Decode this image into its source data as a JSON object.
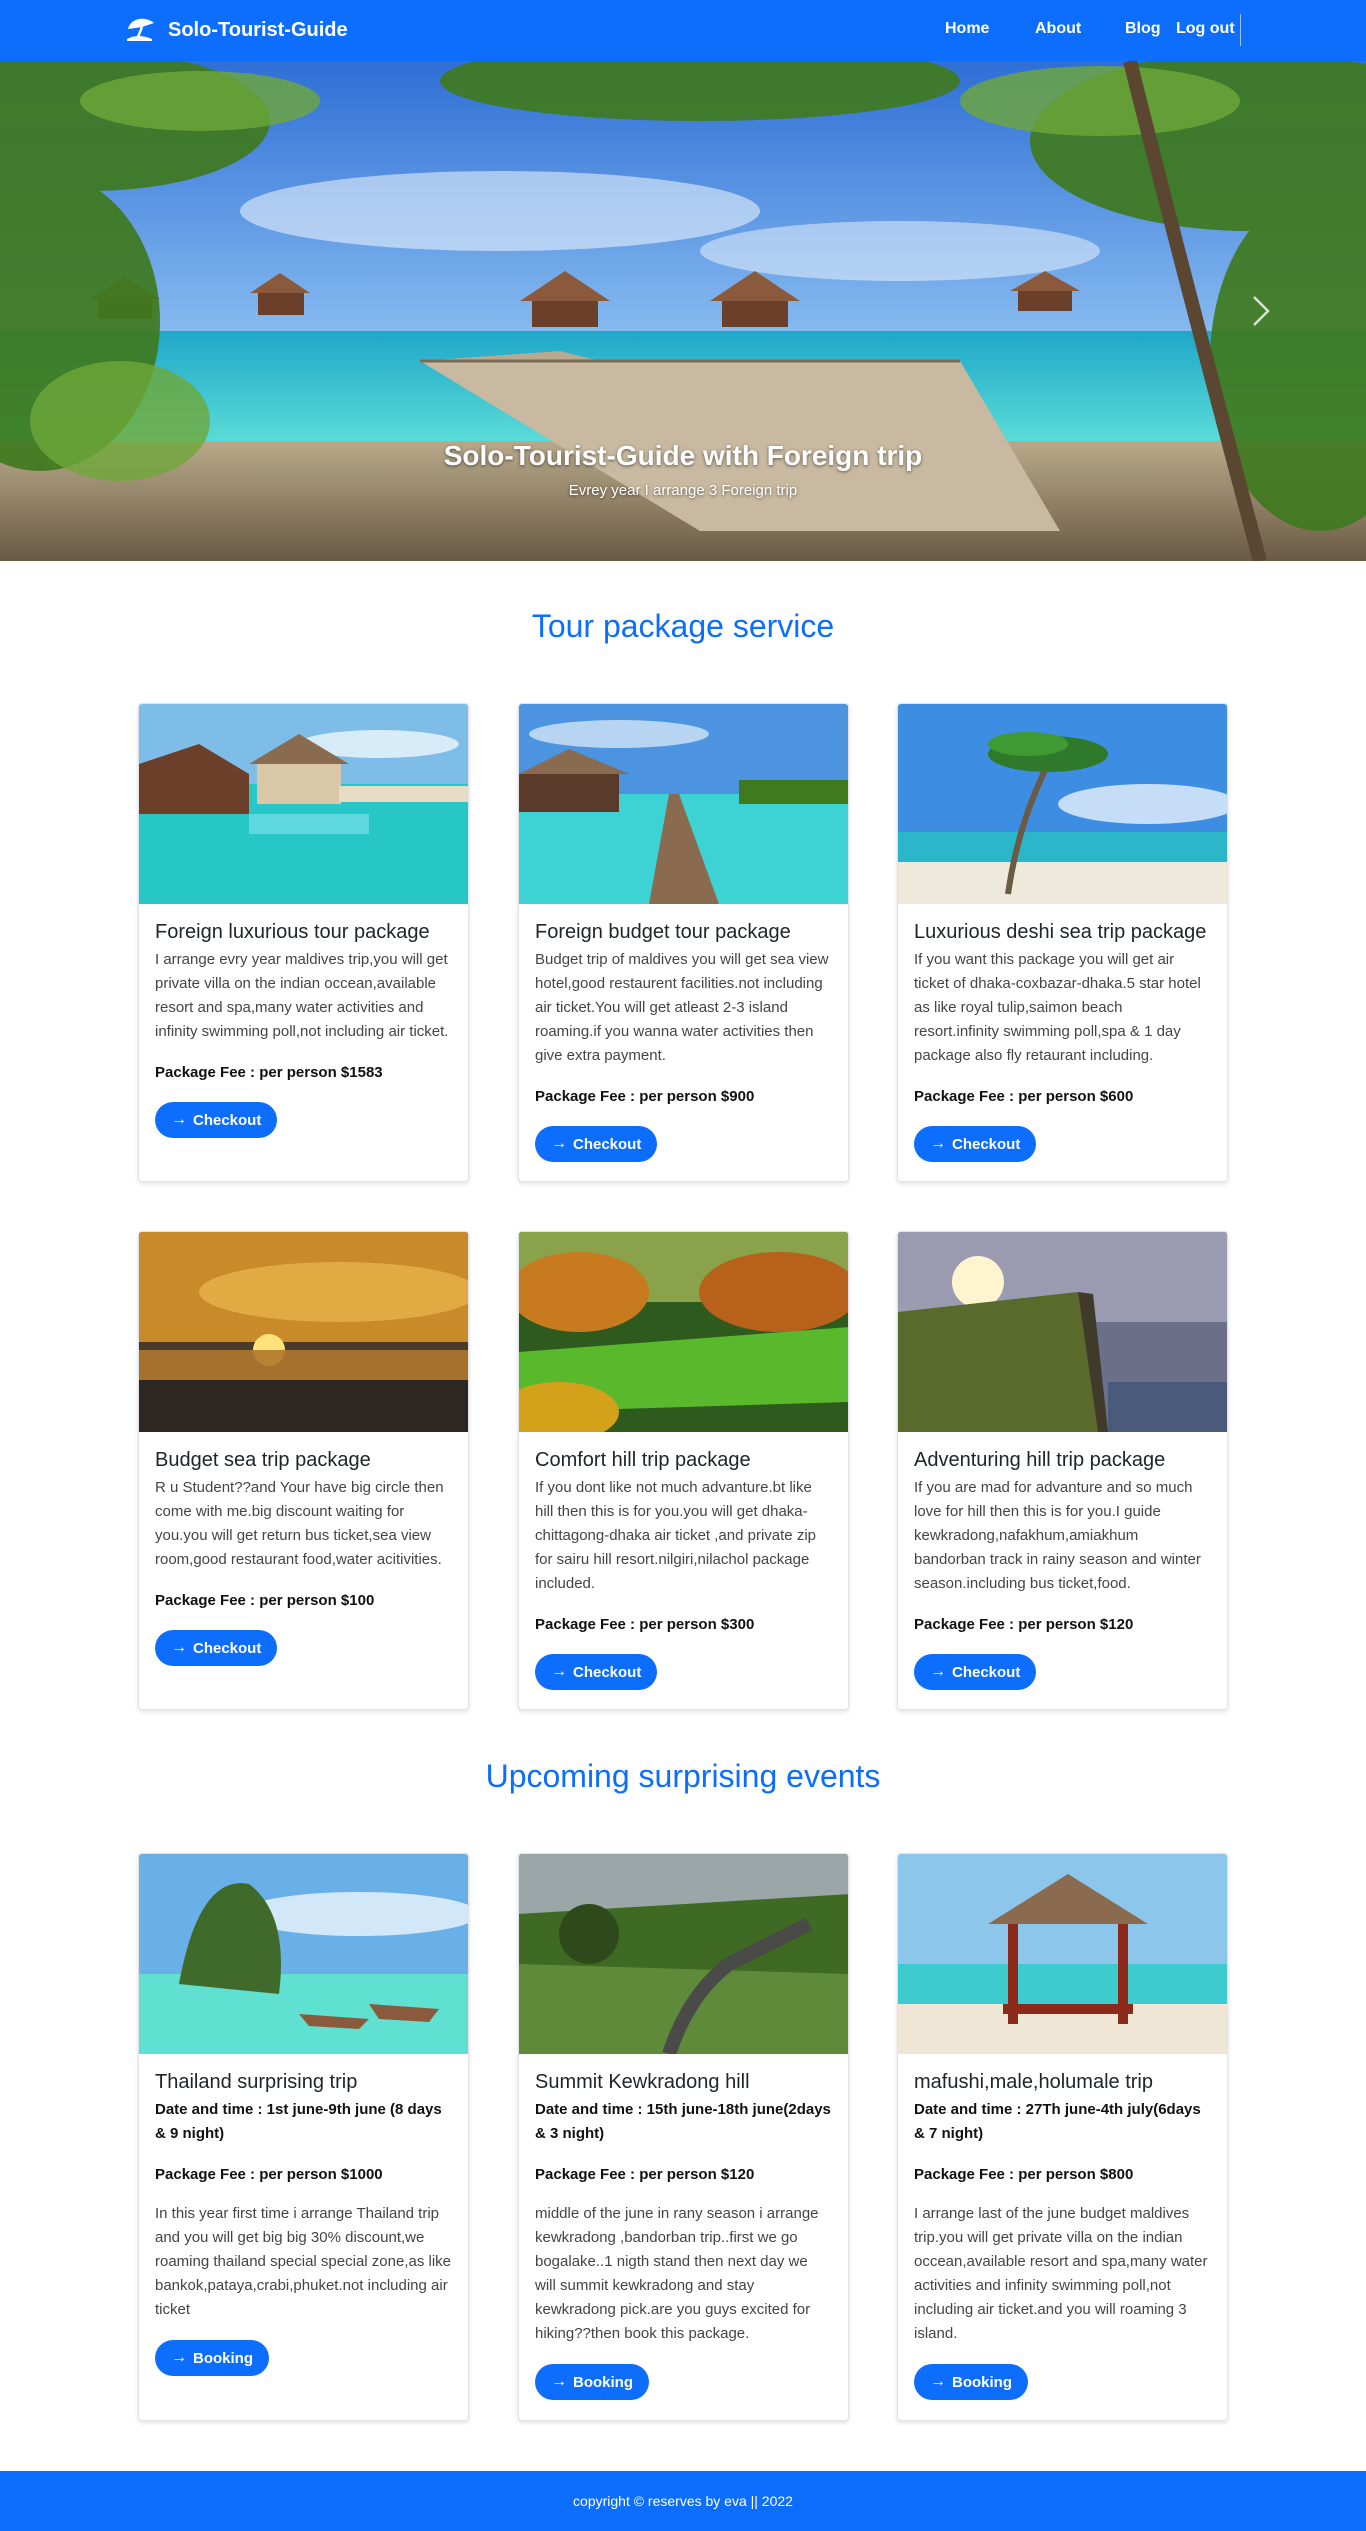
{
  "navbar": {
    "brand": "Solo-Tourist-Guide",
    "home": "Home",
    "about": "About",
    "blog": "Blog",
    "logout": "Log out",
    "color": "#0d6efd"
  },
  "hero": {
    "title": "Solo-Tourist-Guide with Foreign trip",
    "subtitle": "Evrey year I arrange 3 Foreign trip"
  },
  "packages": {
    "section_title": "Tour package service",
    "items": [
      {
        "title": "Foreign luxurious tour package",
        "description": "I arrange evry year maldives trip,you will get private villa on the indian occean,available resort and spa,many water activities and infinity swimming poll,not including air ticket.",
        "fee": "Package Fee : per person $1583",
        "button": "Checkout"
      },
      {
        "title": "Foreign budget tour package",
        "description": "Budget trip of maldives you will get sea view hotel,good restaurent facilities.not including air ticket.You will get atleast 2-3 island roaming.if you wanna water activities then give extra payment.",
        "fee": "Package Fee : per person $900",
        "button": "Checkout"
      },
      {
        "title": "Luxurious deshi sea trip package",
        "description": "If you want this package you will get air ticket of dhaka-coxbazar-dhaka.5 star hotel as like royal tulip,saimon beach resort.infinity swimming poll,spa & 1 day package also fly retaurant including.",
        "fee": "Package Fee : per person $600",
        "button": "Checkout"
      },
      {
        "title": "Budget sea trip package",
        "description": "R u Student??and Your have big circle then come with me.big discount waiting for you.you will get return bus ticket,sea view room,good restaurant food,water acitivities.",
        "fee": "Package Fee : per person $100",
        "button": "Checkout"
      },
      {
        "title": "Comfort hill trip package",
        "description": "If you dont like not much advanture.bt like hill then this is for you.you will get dhaka-chittagong-dhaka air ticket ,and private zip for sairu hill resort.nilgiri,nilachol package included.",
        "fee": "Package Fee : per person $300",
        "button": "Checkout"
      },
      {
        "title": "Adventuring hill trip package",
        "description": "If you are mad for advanture and so much love for hill then this is for you.I guide kewkradong,nafakhum,amiakhum bandorban track in rainy season and winter season.including bus ticket,food.",
        "fee": "Package Fee : per person $120",
        "button": "Checkout"
      }
    ]
  },
  "events": {
    "section_title": "Upcoming surprising events",
    "items": [
      {
        "title": "Thailand surprising trip",
        "date": "Date and time : 1st june-9th june (8 days & 9 night)",
        "fee": "Package Fee : per person $1000",
        "description": "In this year first time i arrange Thailand trip and you will get big big 30% discount,we roaming thailand special special zone,as like bankok,pataya,crabi,phuket.not including air ticket",
        "button": "Booking"
      },
      {
        "title": "Summit Kewkradong hill",
        "date": "Date and time : 15th june-18th june(2days & 3 night)",
        "fee": "Package Fee : per person $120",
        "description": "middle of the june in rany season i arrange kewkradong ,bandorban trip..first we go bogalake..1 nigth stand then next day we will summit kewkradong and stay kewkradong pick.are you guys excited for hiking??then book this package.",
        "button": "Booking"
      },
      {
        "title": "mafushi,male,holumale trip",
        "date": "Date and time : 27Th june-4th july(6days & 7 night)",
        "fee": "Package Fee : per person $800",
        "description": "I arrange last of the june budget maldives trip.you will get private villa on the indian occean,available resort and spa,many water activities and infinity swimming poll,not including air ticket.and you will roaming 3 island.",
        "button": "Booking"
      }
    ]
  },
  "footer": {
    "text": "copyright © reserves by eva || 2022"
  }
}
